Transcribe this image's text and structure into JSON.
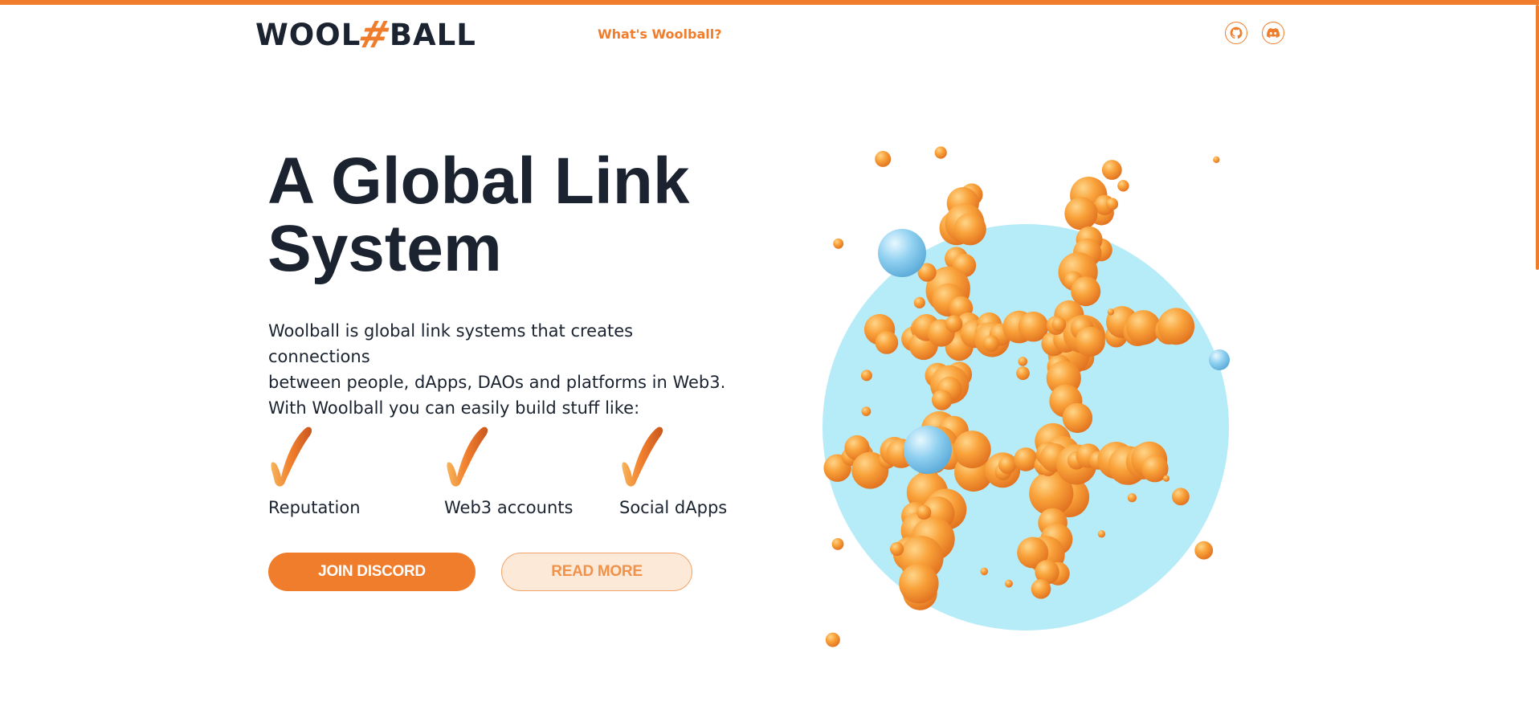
{
  "brand": {
    "logo_left": "WOOL",
    "logo_hash": "#",
    "logo_right": "BALL",
    "accent_color": "#f07d2c",
    "dark_color": "#1b2330",
    "sky_color": "#b6ecf8"
  },
  "nav": {
    "whats_woolball": "What's Woolball?",
    "github_icon": "github-icon",
    "discord_icon": "discord-icon"
  },
  "hero": {
    "title_line1": "A Global Link",
    "title_line2": "System",
    "description_line1": "Woolball is global link systems that creates connections",
    "description_line2": "between people, dApps, DAOs and platforms in Web3.",
    "description_line3": "With Woolball you can easily build stuff like:"
  },
  "features": [
    {
      "label": "Reputation",
      "icon": "checkmark-icon"
    },
    {
      "label": "Web3 accounts",
      "icon": "checkmark-icon"
    },
    {
      "label": "Social dApps",
      "icon": "checkmark-icon"
    }
  ],
  "buttons": {
    "join_discord": "JOIN DISCORD",
    "read_more": "READ MORE"
  },
  "illustration": {
    "icon": "hash-balloons-illustration"
  }
}
